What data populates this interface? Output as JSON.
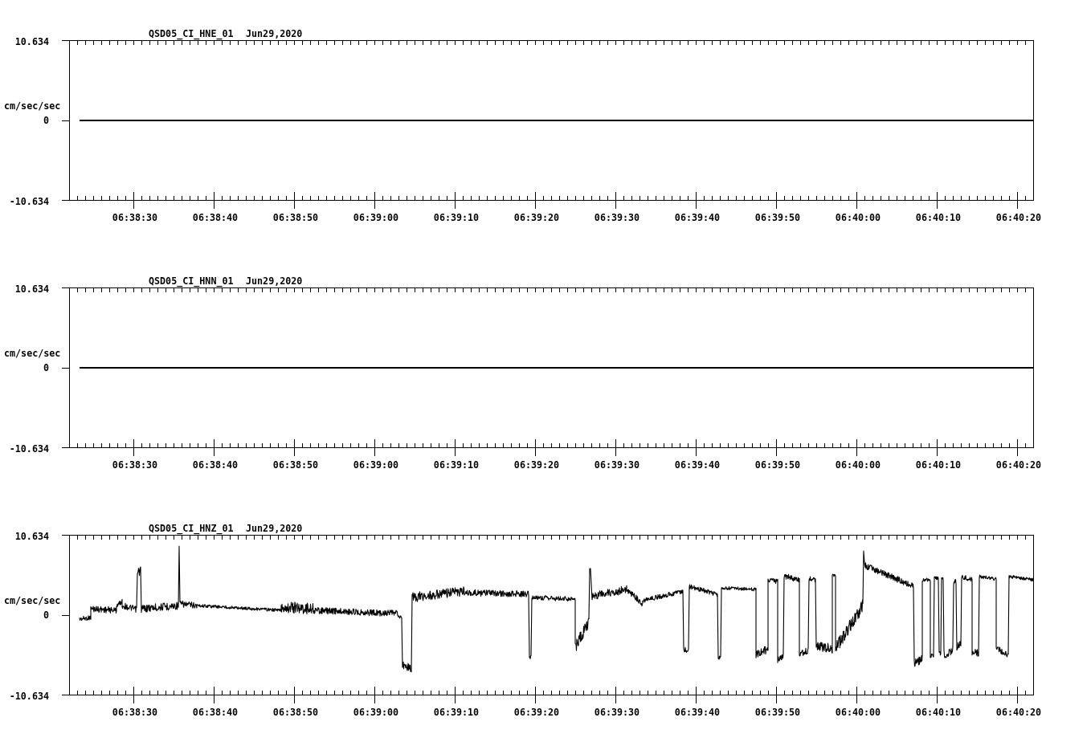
{
  "panels": [
    {
      "kind": "flat",
      "station": "QSD05_CI_HNE_01",
      "date": "Jun29,2020",
      "y_label": "cm/sec/sec",
      "y_ticks": [
        "10.634",
        "0",
        "-10.634"
      ],
      "x_ticks": [
        "06:38:30",
        "06:38:40",
        "06:38:50",
        "06:39:00",
        "06:39:10",
        "06:39:20",
        "06:39:30",
        "06:39:40",
        "06:39:50",
        "06:40:00",
        "06:40:10",
        "06:40:20"
      ]
    },
    {
      "kind": "flat",
      "station": "QSD05_CI_HNN_01",
      "date": "Jun29,2020",
      "y_label": "cm/sec/sec",
      "y_ticks": [
        "10.634",
        "0",
        "-10.634"
      ],
      "x_ticks": [
        "06:38:30",
        "06:38:40",
        "06:38:50",
        "06:39:00",
        "06:39:10",
        "06:39:20",
        "06:39:30",
        "06:39:40",
        "06:39:50",
        "06:40:00",
        "06:40:10",
        "06:40:20"
      ]
    },
    {
      "kind": "waveform",
      "station": "QSD05_CI_HNZ_01",
      "date": "Jun29,2020",
      "y_label": "cm/sec/sec",
      "y_ticks": [
        "10.634",
        "0",
        "-10.634"
      ],
      "x_ticks": [
        "06:38:30",
        "06:38:40",
        "06:38:50",
        "06:39:00",
        "06:39:10",
        "06:39:20",
        "06:39:30",
        "06:39:40",
        "06:39:50",
        "06:40:00",
        "06:40:10",
        "06:40:20"
      ]
    }
  ]
}
